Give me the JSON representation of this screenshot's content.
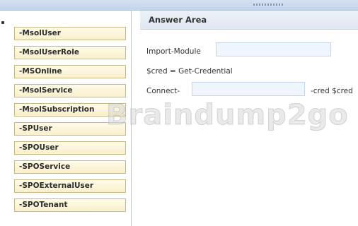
{
  "left_tiles": [
    "-MsolUser",
    "-MsolUserRole",
    "-MSOnline",
    "-MsolService",
    "-MsolSubscription",
    "-SPUser",
    "-SPOUser",
    "-SPOService",
    "-SPOExternalUser",
    "-SPOTenant"
  ],
  "answer_area": {
    "title": "Answer Area",
    "line1_prefix": "Import-Module",
    "line1_input": "",
    "line2": "$cred = Get-Credential",
    "line3_prefix": "Connect-",
    "line3_input": "",
    "line3_suffix": "-cred $cred"
  },
  "watermark": "Braindump2go",
  "colors": {
    "tile_bg": "#f8efcc",
    "tile_border": "#c8b883",
    "answer_box_bg": "#eef5fc",
    "header_bg": "#dfe7f1"
  }
}
